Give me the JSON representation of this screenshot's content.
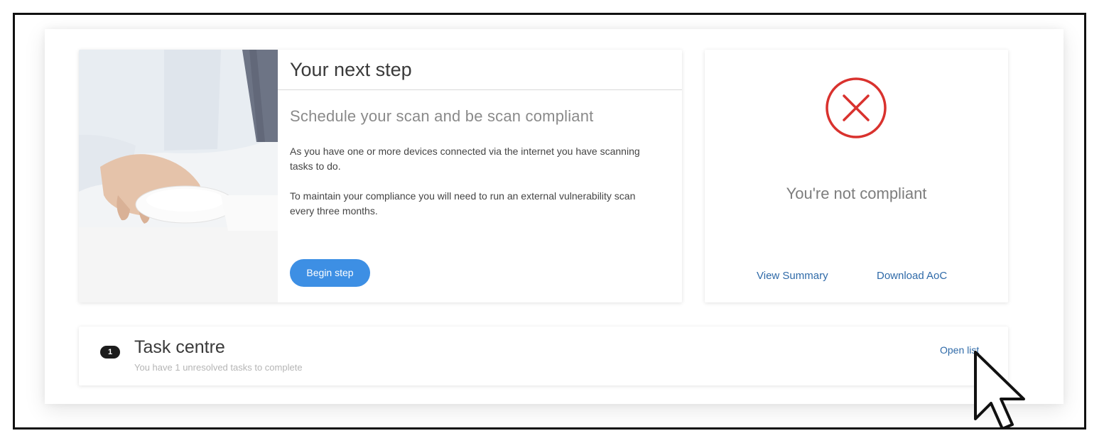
{
  "next_step": {
    "title": "Your next step",
    "subtitle": "Schedule your scan and be scan compliant",
    "paragraph_1": "As you have one or more devices connected via the internet you have scanning tasks to do.",
    "paragraph_2": "To maintain your compliance you will need to run an external vulnerability scan every three months.",
    "button_label": "Begin step",
    "image": "hand-on-computer-mouse-photo"
  },
  "compliance": {
    "status_icon": "error-circle-x-icon",
    "status_color": "#d9322e",
    "status_text": "You're not compliant",
    "view_summary_label": "View Summary",
    "download_label": "Download AoC"
  },
  "task_centre": {
    "count": "1",
    "title": "Task centre",
    "subtitle": "You have 1 unresolved tasks to complete",
    "open_list_label": "Open list"
  },
  "colors": {
    "accent": "#3d8fe4",
    "link": "#2f6aa8",
    "error": "#d9322e"
  },
  "cursor": "arrow-pointer-icon"
}
